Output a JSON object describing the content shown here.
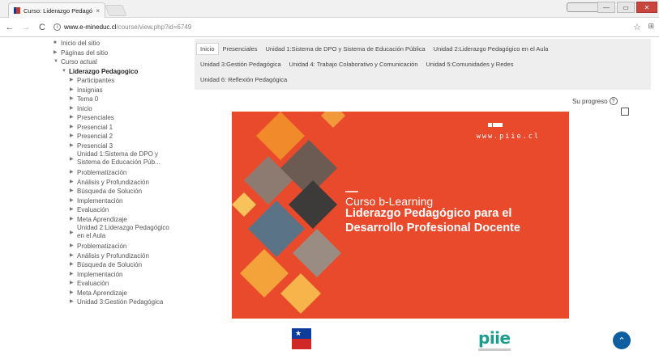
{
  "browser": {
    "tab_title": "Curso: Liderazgo Pedagó",
    "tab_close": "×",
    "url_host": "www.e-mineduc.cl",
    "url_path": "/course/view.php?id=6749",
    "nav_back": "←",
    "nav_forward": "→",
    "nav_reload": "C",
    "info": "i",
    "star": "☆",
    "extension": "⊞",
    "minimize": "—",
    "restore": "▭",
    "close": "✕"
  },
  "sidebar": {
    "items": [
      {
        "label": "Inicio del sitio",
        "caret": "■",
        "bold": false
      },
      {
        "label": "Páginas del sitio",
        "caret": "▶",
        "bold": false
      },
      {
        "label": "Curso actual",
        "caret": "▼",
        "bold": false
      },
      {
        "label": "Liderazgo Pedagogico",
        "caret": "▼",
        "bold": true
      },
      {
        "label": "Participantes",
        "caret": "▶"
      },
      {
        "label": "Insignias",
        "caret": "▶"
      },
      {
        "label": "Tema 0",
        "caret": "▶"
      },
      {
        "label": "Inicio",
        "caret": "▶"
      },
      {
        "label": "Presenciales",
        "caret": "▶"
      },
      {
        "label": "Presencial 1",
        "caret": "▶"
      },
      {
        "label": "Presencial 2",
        "caret": "▶"
      },
      {
        "label": "Presencial 3",
        "caret": "▶"
      },
      {
        "label": "Unidad 1:Sistema de DPO y Sistema de Educación Púb...",
        "caret": "▶",
        "double": true
      },
      {
        "label": "Problematización",
        "caret": "▶"
      },
      {
        "label": "Análisis y Profundización",
        "caret": "▶"
      },
      {
        "label": "Búsqueda de Solución",
        "caret": "▶"
      },
      {
        "label": "Implementación",
        "caret": "▶"
      },
      {
        "label": "Evaluación",
        "caret": "▶"
      },
      {
        "label": "Meta Aprendizaje",
        "caret": "▶"
      },
      {
        "label": "Unidad 2:Liderazgo Pedagógico en el Aula",
        "caret": "▶",
        "double": true
      },
      {
        "label": "Problematización",
        "caret": "▶"
      },
      {
        "label": "Análisis y Profundización",
        "caret": "▶"
      },
      {
        "label": "Búsqueda de Solución",
        "caret": "▶"
      },
      {
        "label": "Implementación",
        "caret": "▶"
      },
      {
        "label": "Evaluación",
        "caret": "▶"
      },
      {
        "label": "Meta Aprendizaje",
        "caret": "▶"
      },
      {
        "label": "Unidad 3:Gestión Pedagógica",
        "caret": "▶"
      }
    ]
  },
  "topnav": {
    "rows": [
      [
        "Inicio",
        "Presenciales",
        "Unidad 1:Sistema de DPO y Sistema de Educación Pública",
        "Unidad 2:Liderazgo Pedagógico en el Aula"
      ],
      [
        "Unidad 3:Gestión Pedagógica",
        "Unidad 4: Trabajo Colaborativo y Comunicación",
        "Unidad 5:Comunidades y Redes"
      ],
      [
        "Unidad 6: Reflexión Pedagógica"
      ]
    ]
  },
  "progress": {
    "label": "Su progreso",
    "help": "?"
  },
  "banner": {
    "url": "www.piie.cl",
    "subtitle": "Curso b-Learning",
    "title": "Liderazgo Pedagógico para el Desarrollo Profesional Docente",
    "color": "#ea4a2c"
  },
  "logos": {
    "piie": "piie",
    "gov_star": "★"
  },
  "scroll_top": "⌃"
}
